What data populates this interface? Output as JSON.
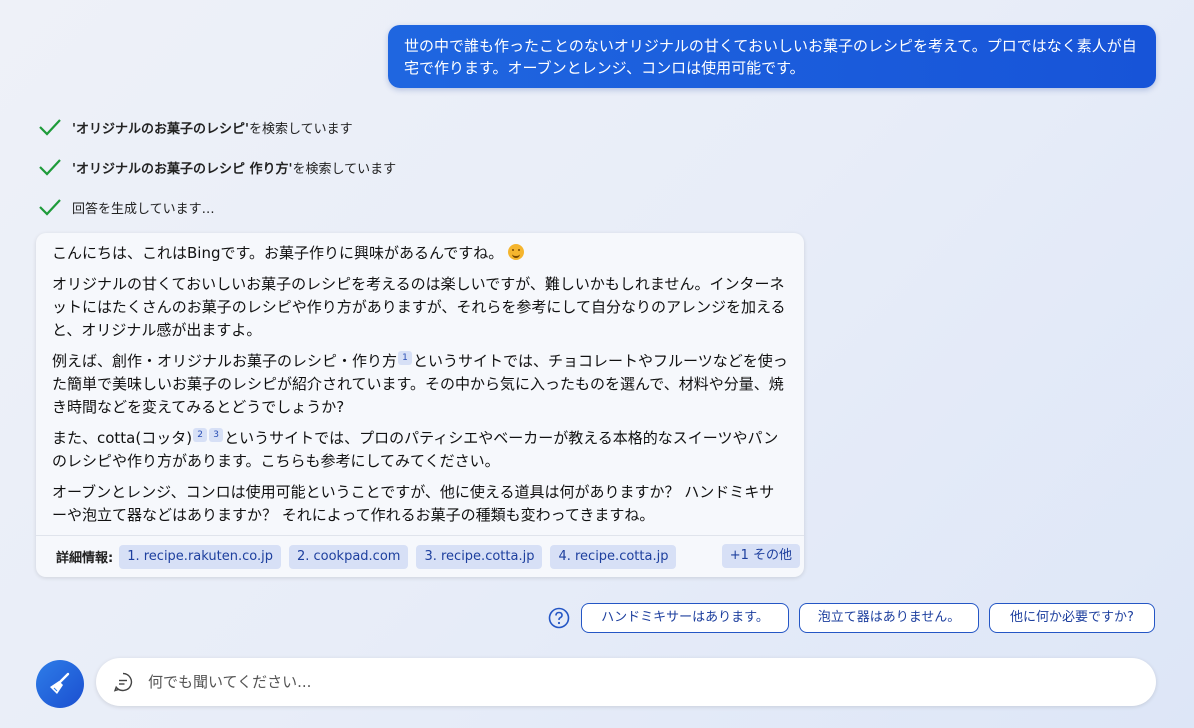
{
  "user_message": "世の中で誰も作ったことのないオリジナルの甘くておいしいお菓子のレシピを考えて。プロではなく素人が自宅で作ります。オーブンとレンジ、コンロは使用可能です。",
  "status": [
    {
      "query": "'オリジナルのお菓子のレシピ'",
      "suffix": " を検索しています"
    },
    {
      "query": "'オリジナルのお菓子のレシピ 作り方'",
      "suffix": " を検索しています"
    },
    {
      "query": "",
      "suffix": "回答を生成しています…"
    }
  ],
  "answer": {
    "p1": "こんにちは、これはBingです。お菓子作りに興味があるんですね。",
    "p2": "オリジナルの甘くておいしいお菓子のレシピを考えるのは楽しいですが、難しいかもしれません。インターネットにはたくさんのお菓子のレシピや作り方がありますが、それらを参考にして自分なりのアレンジを加えると、オリジナル感が出ますよ。",
    "p3a": "例えば、創作・オリジナルお菓子のレシピ・作り方",
    "p3_sup": "1",
    "p3b": "というサイトでは、チョコレートやフルーツなどを使った簡単で美味しいお菓子のレシピが紹介されています。その中から気に入ったものを選んで、材料や分量、焼き時間などを変えてみるとどうでしょうか?",
    "p4a": "また、cotta(コッタ)",
    "p4_sup1": "2",
    "p4_sup2": "3",
    "p4b": "というサイトでは、プロのパティシエやベーカーが教える本格的なスイーツやパンのレシピや作り方があります。こちらも参考にしてみてください。",
    "p5": "オーブンとレンジ、コンロは使用可能ということですが、他に使える道具は何がありますか？ ハンドミキサーや泡立て器などはありますか？ それによって作れるお菓子の種類も変わってきますね。"
  },
  "references": {
    "label": "詳細情報:",
    "items": [
      "1. recipe.rakuten.co.jp",
      "2. cookpad.com",
      "3. recipe.cotta.jp",
      "4. recipe.cotta.jp"
    ],
    "more": "+1 その他"
  },
  "suggestions": [
    "ハンドミキサーはあります。",
    "泡立て器はありません。",
    "他に何か必要ですか?"
  ],
  "input": {
    "placeholder": "何でも聞いてください..."
  },
  "colors": {
    "accent": "#1754d8",
    "check": "#1e9b3a",
    "chip_bg": "#d7e0f6"
  }
}
